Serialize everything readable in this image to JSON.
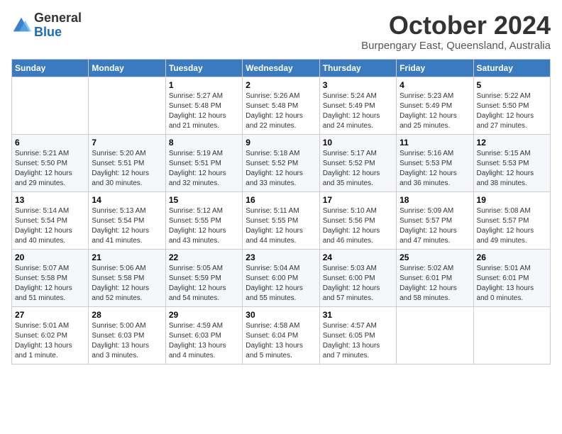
{
  "header": {
    "logo_general": "General",
    "logo_blue": "Blue",
    "month_title": "October 2024",
    "subtitle": "Burpengary East, Queensland, Australia"
  },
  "days_of_week": [
    "Sunday",
    "Monday",
    "Tuesday",
    "Wednesday",
    "Thursday",
    "Friday",
    "Saturday"
  ],
  "weeks": [
    [
      {
        "day": "",
        "info": ""
      },
      {
        "day": "",
        "info": ""
      },
      {
        "day": "1",
        "info": "Sunrise: 5:27 AM\nSunset: 5:48 PM\nDaylight: 12 hours and 21 minutes."
      },
      {
        "day": "2",
        "info": "Sunrise: 5:26 AM\nSunset: 5:48 PM\nDaylight: 12 hours and 22 minutes."
      },
      {
        "day": "3",
        "info": "Sunrise: 5:24 AM\nSunset: 5:49 PM\nDaylight: 12 hours and 24 minutes."
      },
      {
        "day": "4",
        "info": "Sunrise: 5:23 AM\nSunset: 5:49 PM\nDaylight: 12 hours and 25 minutes."
      },
      {
        "day": "5",
        "info": "Sunrise: 5:22 AM\nSunset: 5:50 PM\nDaylight: 12 hours and 27 minutes."
      }
    ],
    [
      {
        "day": "6",
        "info": "Sunrise: 5:21 AM\nSunset: 5:50 PM\nDaylight: 12 hours and 29 minutes."
      },
      {
        "day": "7",
        "info": "Sunrise: 5:20 AM\nSunset: 5:51 PM\nDaylight: 12 hours and 30 minutes."
      },
      {
        "day": "8",
        "info": "Sunrise: 5:19 AM\nSunset: 5:51 PM\nDaylight: 12 hours and 32 minutes."
      },
      {
        "day": "9",
        "info": "Sunrise: 5:18 AM\nSunset: 5:52 PM\nDaylight: 12 hours and 33 minutes."
      },
      {
        "day": "10",
        "info": "Sunrise: 5:17 AM\nSunset: 5:52 PM\nDaylight: 12 hours and 35 minutes."
      },
      {
        "day": "11",
        "info": "Sunrise: 5:16 AM\nSunset: 5:53 PM\nDaylight: 12 hours and 36 minutes."
      },
      {
        "day": "12",
        "info": "Sunrise: 5:15 AM\nSunset: 5:53 PM\nDaylight: 12 hours and 38 minutes."
      }
    ],
    [
      {
        "day": "13",
        "info": "Sunrise: 5:14 AM\nSunset: 5:54 PM\nDaylight: 12 hours and 40 minutes."
      },
      {
        "day": "14",
        "info": "Sunrise: 5:13 AM\nSunset: 5:54 PM\nDaylight: 12 hours and 41 minutes."
      },
      {
        "day": "15",
        "info": "Sunrise: 5:12 AM\nSunset: 5:55 PM\nDaylight: 12 hours and 43 minutes."
      },
      {
        "day": "16",
        "info": "Sunrise: 5:11 AM\nSunset: 5:55 PM\nDaylight: 12 hours and 44 minutes."
      },
      {
        "day": "17",
        "info": "Sunrise: 5:10 AM\nSunset: 5:56 PM\nDaylight: 12 hours and 46 minutes."
      },
      {
        "day": "18",
        "info": "Sunrise: 5:09 AM\nSunset: 5:57 PM\nDaylight: 12 hours and 47 minutes."
      },
      {
        "day": "19",
        "info": "Sunrise: 5:08 AM\nSunset: 5:57 PM\nDaylight: 12 hours and 49 minutes."
      }
    ],
    [
      {
        "day": "20",
        "info": "Sunrise: 5:07 AM\nSunset: 5:58 PM\nDaylight: 12 hours and 51 minutes."
      },
      {
        "day": "21",
        "info": "Sunrise: 5:06 AM\nSunset: 5:58 PM\nDaylight: 12 hours and 52 minutes."
      },
      {
        "day": "22",
        "info": "Sunrise: 5:05 AM\nSunset: 5:59 PM\nDaylight: 12 hours and 54 minutes."
      },
      {
        "day": "23",
        "info": "Sunrise: 5:04 AM\nSunset: 6:00 PM\nDaylight: 12 hours and 55 minutes."
      },
      {
        "day": "24",
        "info": "Sunrise: 5:03 AM\nSunset: 6:00 PM\nDaylight: 12 hours and 57 minutes."
      },
      {
        "day": "25",
        "info": "Sunrise: 5:02 AM\nSunset: 6:01 PM\nDaylight: 12 hours and 58 minutes."
      },
      {
        "day": "26",
        "info": "Sunrise: 5:01 AM\nSunset: 6:01 PM\nDaylight: 13 hours and 0 minutes."
      }
    ],
    [
      {
        "day": "27",
        "info": "Sunrise: 5:01 AM\nSunset: 6:02 PM\nDaylight: 13 hours and 1 minute."
      },
      {
        "day": "28",
        "info": "Sunrise: 5:00 AM\nSunset: 6:03 PM\nDaylight: 13 hours and 3 minutes."
      },
      {
        "day": "29",
        "info": "Sunrise: 4:59 AM\nSunset: 6:03 PM\nDaylight: 13 hours and 4 minutes."
      },
      {
        "day": "30",
        "info": "Sunrise: 4:58 AM\nSunset: 6:04 PM\nDaylight: 13 hours and 5 minutes."
      },
      {
        "day": "31",
        "info": "Sunrise: 4:57 AM\nSunset: 6:05 PM\nDaylight: 13 hours and 7 minutes."
      },
      {
        "day": "",
        "info": ""
      },
      {
        "day": "",
        "info": ""
      }
    ]
  ]
}
